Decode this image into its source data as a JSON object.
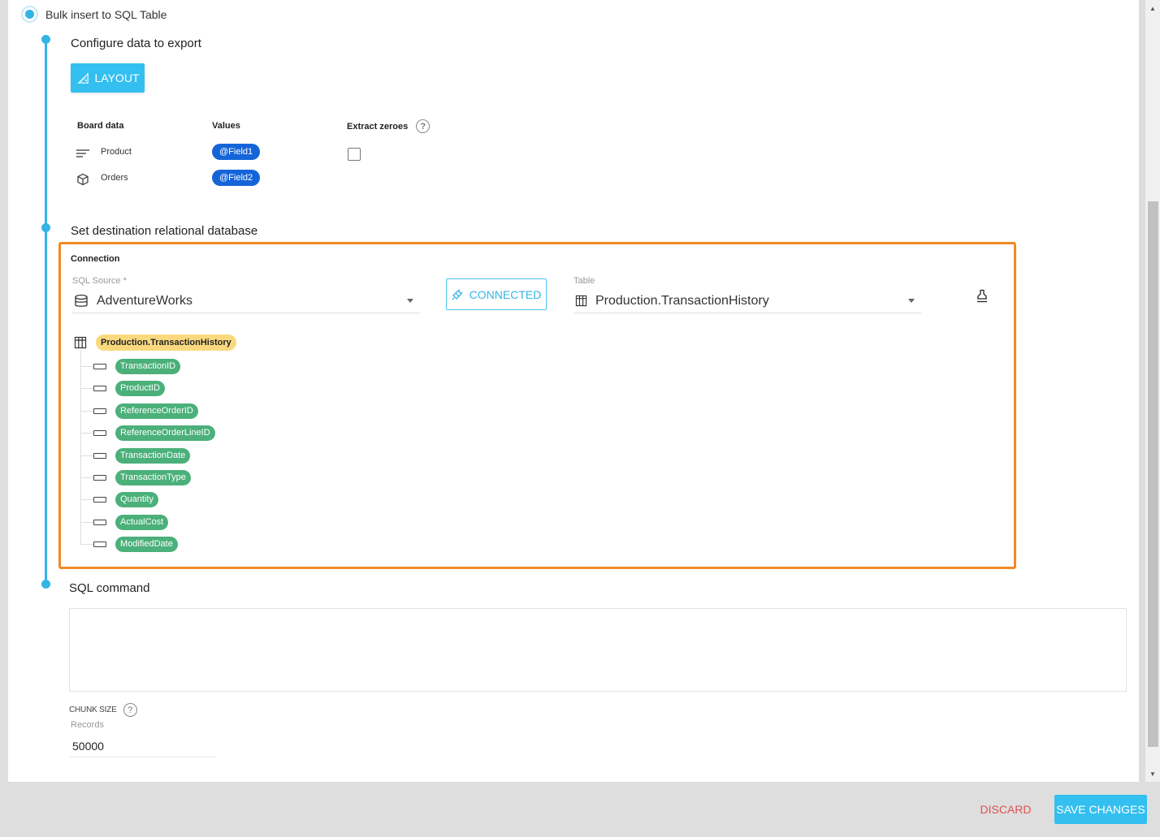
{
  "option": {
    "label": "Bulk insert to SQL Table",
    "selected": true
  },
  "steps": {
    "configure": {
      "title": "Configure data to export",
      "layout_button": "LAYOUT",
      "columns": {
        "board_data": "Board data",
        "values": "Values",
        "extract_zeroes": "Extract zeroes"
      },
      "help_glyph": "?",
      "rows": [
        {
          "icon": "text-lines-icon",
          "label": "Product",
          "value": "@Field1"
        },
        {
          "icon": "cube-icon",
          "label": "Orders",
          "value": "@Field2"
        }
      ],
      "extract_zeroes_checked": false
    },
    "destination": {
      "title": "Set destination relational database",
      "connection_title": "Connection",
      "sql_source_label": "SQL Source *",
      "sql_source_value": "AdventureWorks",
      "connected_button": "CONNECTED",
      "table_label": "Table",
      "table_value": "Production.TransactionHistory",
      "tree": {
        "table": "Production.TransactionHistory",
        "columns": [
          "TransactionID",
          "ProductID",
          "ReferenceOrderID",
          "ReferenceOrderLineID",
          "TransactionDate",
          "TransactionType",
          "Quantity",
          "ActualCost",
          "ModifiedDate"
        ]
      }
    },
    "sql": {
      "title": "SQL command",
      "command": "",
      "chunk_size_label": "CHUNK SIZE",
      "records_label": "Records",
      "records_value": "50000"
    }
  },
  "footer": {
    "discard": "DISCARD",
    "save": "SAVE CHANGES"
  },
  "colors": {
    "accent": "#33b5e5",
    "highlight_border": "#f08a24",
    "field_chip": "#1565d8",
    "column_chip": "#4bb07a",
    "table_chip": "#fad97e",
    "discard": "#e05050"
  }
}
